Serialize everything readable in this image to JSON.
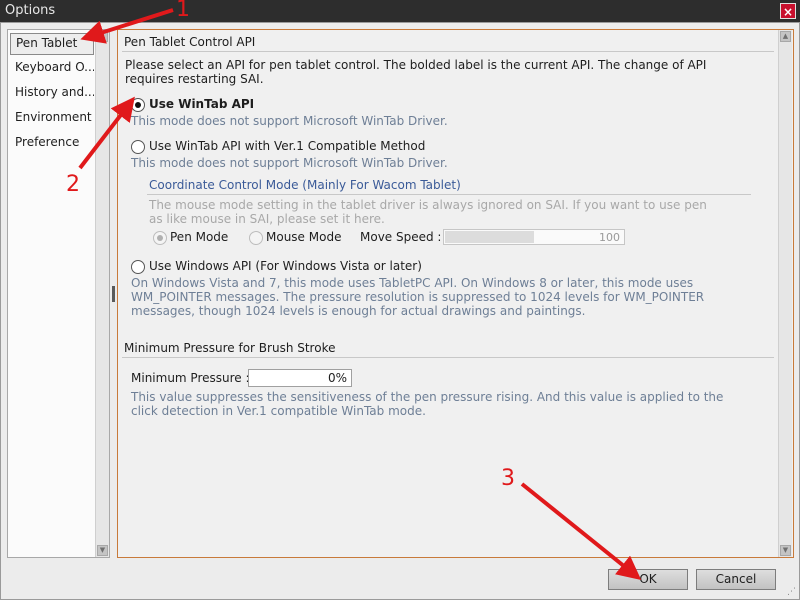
{
  "window": {
    "title": "Options",
    "close_glyph": "×"
  },
  "nav": {
    "items": [
      {
        "label": "Pen Tablet",
        "selected": true
      },
      {
        "label": "Keyboard O..."
      },
      {
        "label": "History and..."
      },
      {
        "label": "Environment"
      },
      {
        "label": "Preference"
      }
    ]
  },
  "pen_api": {
    "header": "Pen Tablet Control API",
    "intro": "Please select an API for pen tablet control. The bolded label is the current API. The change of API requires restarting SAI.",
    "options": [
      {
        "label": "Use WinTab API",
        "desc": "This mode does not support Microsoft WinTab Driver.",
        "checked": true
      },
      {
        "label": "Use WinTab API with Ver.1 Compatible Method",
        "desc": "This mode does not support Microsoft WinTab Driver.",
        "checked": false
      },
      {
        "label": "Use Windows API (For Windows Vista or later)",
        "desc": "On Windows Vista and 7, this mode uses TabletPC API. On Windows 8 or later, this mode uses WM_POINTER messages. The pressure resolution is suppressed to 1024 levels for WM_POINTER messages, though 1024 levels is enough for actual drawings and paintings.",
        "checked": false
      }
    ],
    "coord_mode": {
      "header": "Coordinate Control Mode (Mainly For Wacom Tablet)",
      "desc": "The mouse mode setting in the tablet driver is always ignored on SAI. If you want to use pen as like mouse in SAI, please set it here.",
      "pen_mode": "Pen Mode",
      "mouse_mode": "Mouse Mode",
      "speed_label": "Move Speed :",
      "speed_value": "100",
      "speed_fraction": 0.5
    }
  },
  "min_pressure": {
    "header": "Minimum Pressure for Brush Stroke",
    "label": "Minimum Pressure :",
    "value": "0%",
    "desc": "This value suppresses the sensitiveness of the pen pressure rising. And this value is applied to the click detection in Ver.1 compatible WinTab mode."
  },
  "buttons": {
    "ok": "OK",
    "cancel": "Cancel"
  },
  "annotations": {
    "n1": "1",
    "n2": "2",
    "n3": "3",
    "color": "#e0191b"
  },
  "scroll_glyphs": {
    "up": "▲",
    "down": "▼"
  },
  "grip_glyph": "⋰"
}
